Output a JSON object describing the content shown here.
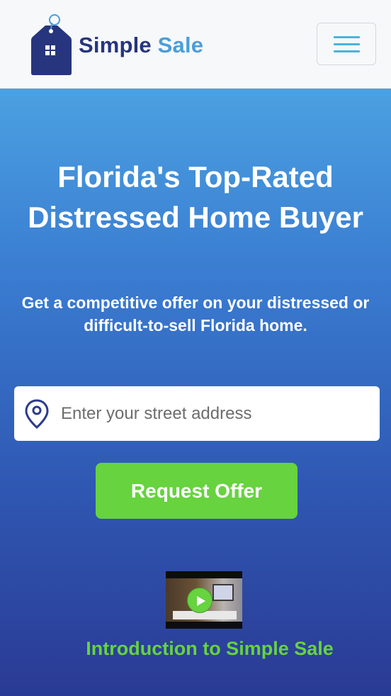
{
  "brand": {
    "name_part1": "Simple",
    "name_part2": "Sale",
    "primary_color": "#27357e",
    "accent_color": "#4a9ed9"
  },
  "nav": {
    "menu_icon": "hamburger-menu-icon"
  },
  "hero": {
    "title": "Florida's Top-Rated Distressed Home Buyer",
    "subtitle": "Get a competitive offer on your distressed or difficult-to-sell Florida home."
  },
  "address_form": {
    "icon": "location-pin-icon",
    "placeholder": "Enter your street address",
    "value": "",
    "submit_label": "Request Offer",
    "submit_color": "#66d33f"
  },
  "video": {
    "icon": "play-icon",
    "title": "Introduction to Simple Sale"
  }
}
